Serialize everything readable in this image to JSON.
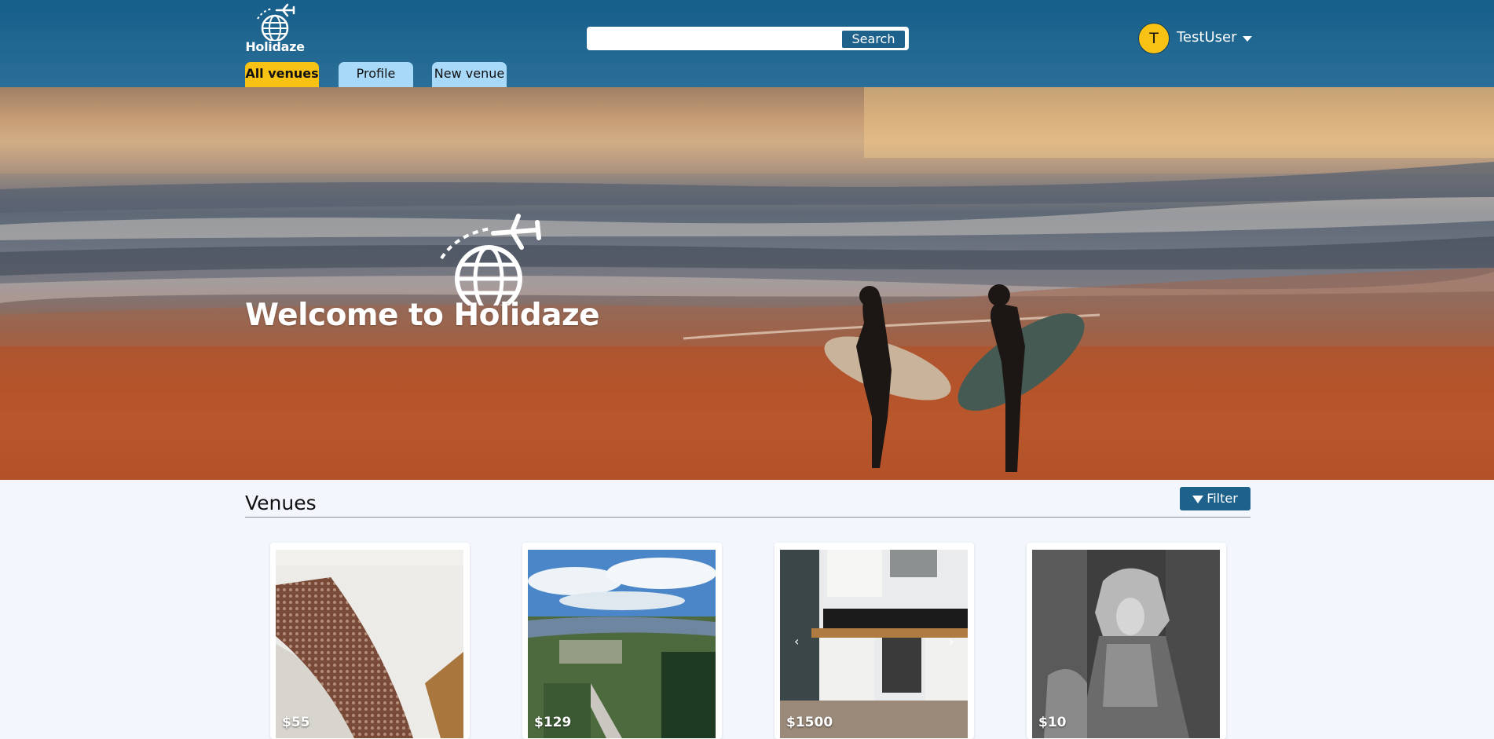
{
  "header": {
    "logo_text": "Holidaze",
    "search": {
      "value": "",
      "placeholder": "",
      "button_label": "Search"
    },
    "user": {
      "initial": "T",
      "name": "TestUser"
    },
    "tabs": [
      {
        "label": "All venues",
        "active": true
      },
      {
        "label": "Profile",
        "active": false
      },
      {
        "label": "New venue",
        "active": false
      }
    ]
  },
  "hero": {
    "title": "Welcome to Holidaze"
  },
  "venues": {
    "title": "Venues",
    "filter_label": "Filter",
    "cards": [
      {
        "price": "$55"
      },
      {
        "price": "$129"
      },
      {
        "price": "$1500"
      },
      {
        "price": "$10"
      }
    ]
  },
  "colors": {
    "header": "#1e628c",
    "accent": "#f8c215",
    "tab_inactive": "#a9d9f8",
    "page_bg": "#f3f7fd"
  },
  "icons": [
    "globe-plane-logo-icon",
    "caret-down-icon",
    "filter-icon",
    "carousel-prev-icon",
    "carousel-next-icon"
  ]
}
